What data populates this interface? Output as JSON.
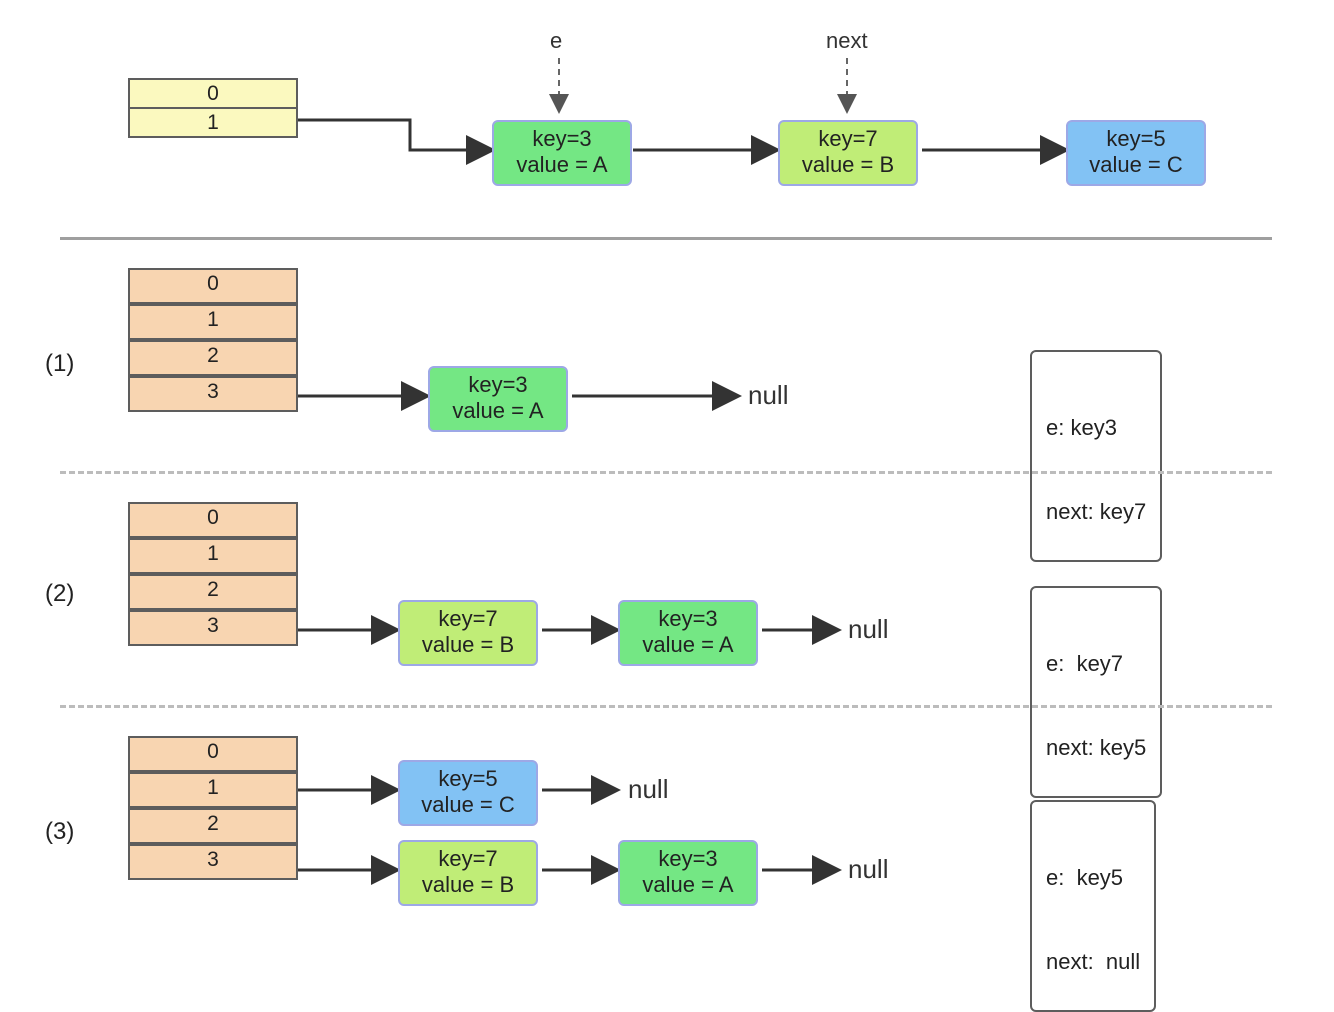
{
  "top": {
    "pointer_e": "e",
    "pointer_next": "next",
    "table": [
      "0",
      "1"
    ],
    "chain": [
      {
        "key": "key=3",
        "val": "value = A",
        "color": "green"
      },
      {
        "key": "key=7",
        "val": "value = B",
        "color": "lime"
      },
      {
        "key": "key=5",
        "val": "value = C",
        "color": "blue"
      }
    ]
  },
  "steps": [
    {
      "label": "(1)",
      "table": [
        "0",
        "1",
        "2",
        "3"
      ],
      "slot": 3,
      "rows": [
        {
          "chain": [
            {
              "key": "key=3",
              "val": "value = A",
              "color": "green"
            }
          ],
          "null": "null"
        }
      ],
      "state": {
        "e": "e: key3",
        "next": "next: key7"
      }
    },
    {
      "label": "(2)",
      "table": [
        "0",
        "1",
        "2",
        "3"
      ],
      "slot": 3,
      "rows": [
        {
          "chain": [
            {
              "key": "key=7",
              "val": "value = B",
              "color": "lime"
            },
            {
              "key": "key=3",
              "val": "value = A",
              "color": "green"
            }
          ],
          "null": "null"
        }
      ],
      "state": {
        "e": "e:  key7",
        "next": "next: key5"
      }
    },
    {
      "label": "(3)",
      "table": [
        "0",
        "1",
        "2",
        "3"
      ],
      "rows": [
        {
          "slot": 1,
          "chain": [
            {
              "key": "key=5",
              "val": "value = C",
              "color": "blue"
            }
          ],
          "null": "null"
        },
        {
          "slot": 3,
          "chain": [
            {
              "key": "key=7",
              "val": "value = B",
              "color": "lime"
            },
            {
              "key": "key=3",
              "val": "value = A",
              "color": "green"
            }
          ],
          "null": "null"
        }
      ],
      "state": {
        "e": "e:  key5",
        "next": "next:  null"
      }
    }
  ]
}
